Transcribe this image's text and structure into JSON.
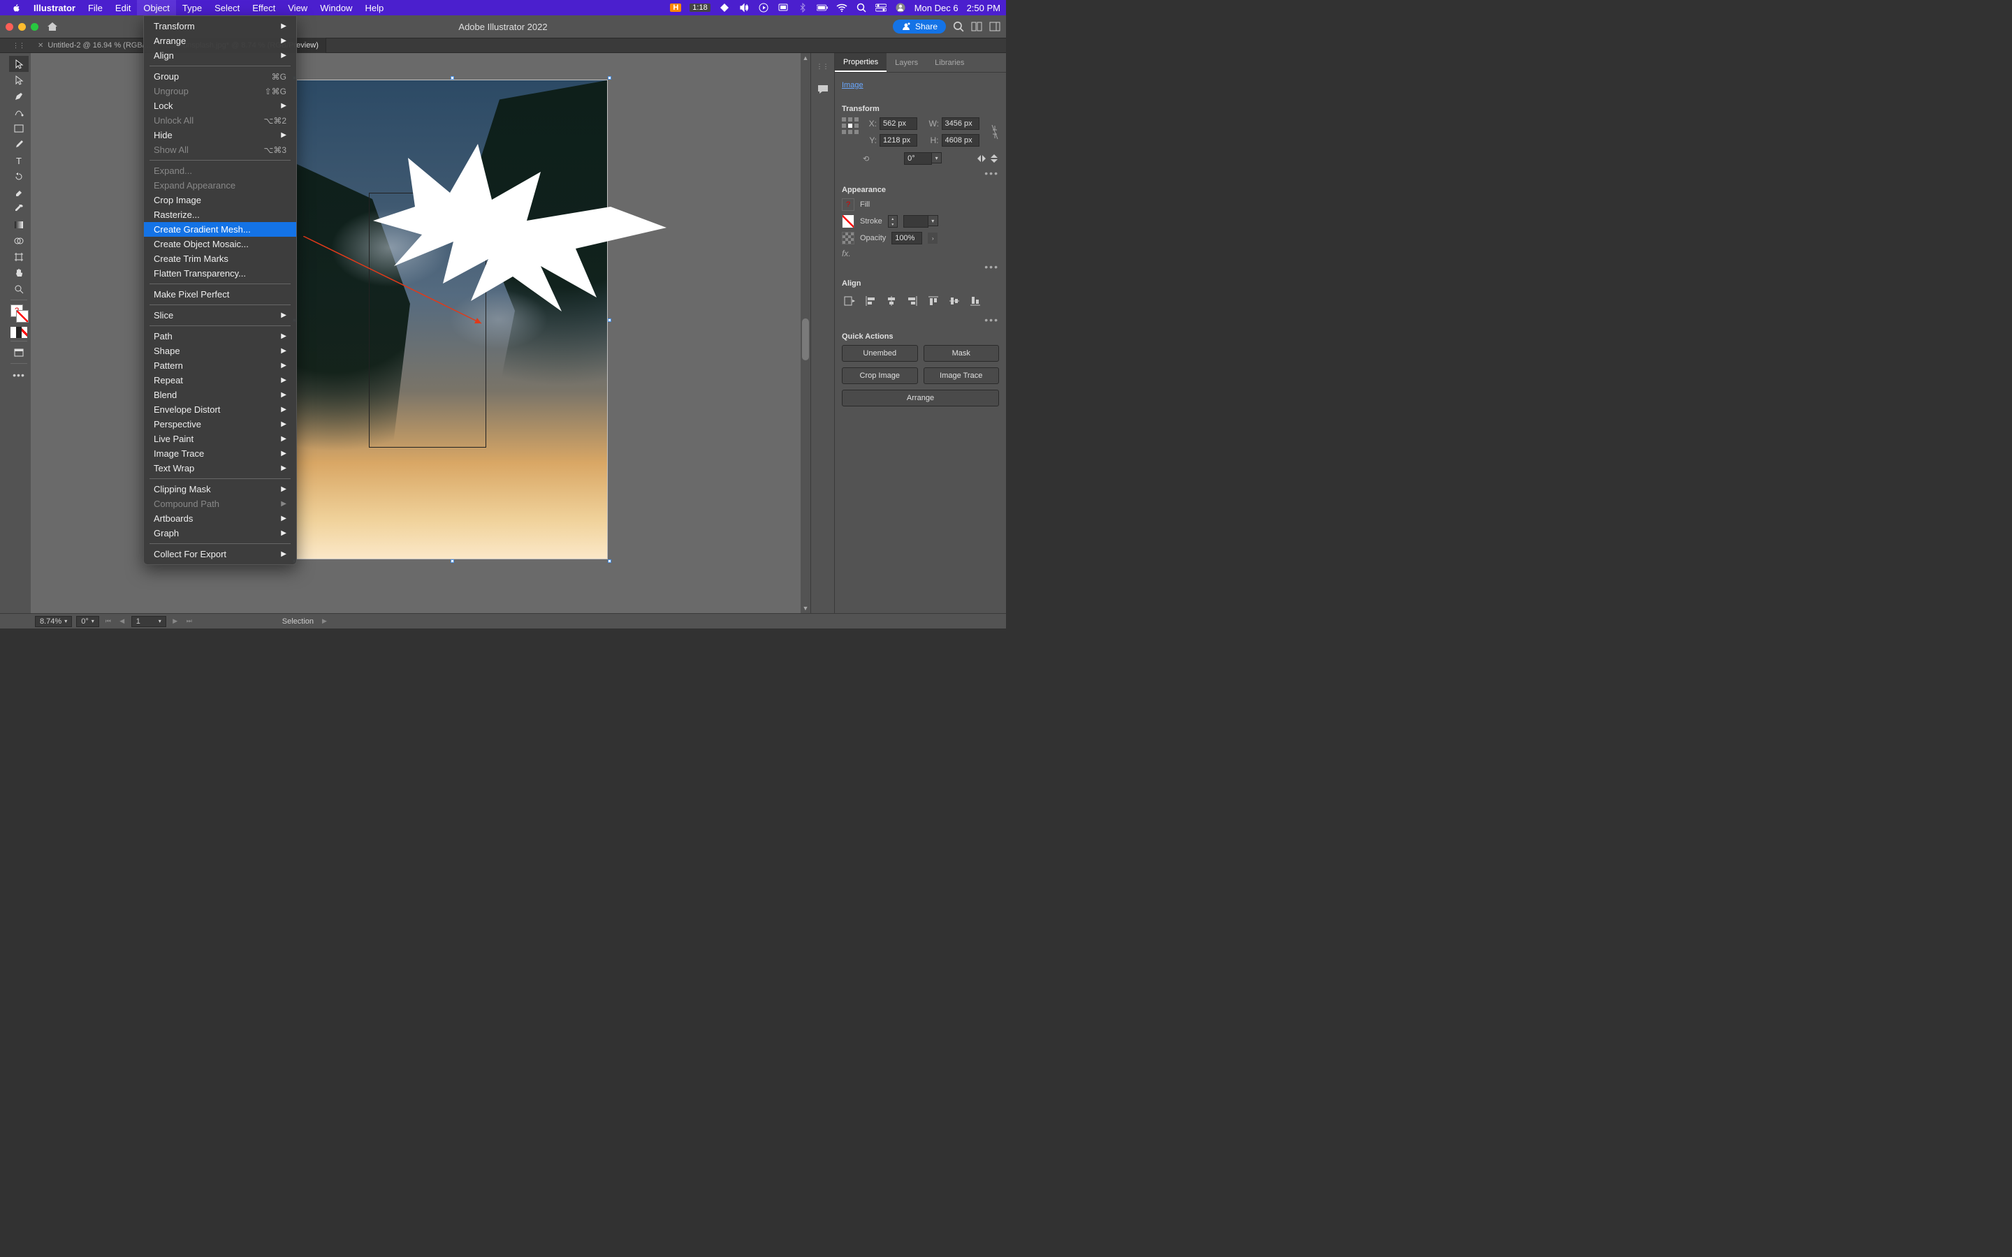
{
  "menubar": {
    "app": "Illustrator",
    "items": [
      "File",
      "Edit",
      "Object",
      "Type",
      "Select",
      "Effect",
      "View",
      "Window",
      "Help"
    ],
    "active_index": 2,
    "right": {
      "h": "H",
      "htime": "1:18",
      "date": "Mon Dec 6",
      "time": "2:50 PM"
    }
  },
  "apptoolbar": {
    "title": "Adobe Illustrator 2022",
    "share": "Share"
  },
  "tabs": [
    {
      "label": "Untitled-2 @ 16.94 % (RGB/...",
      "active": false
    },
    {
      "label": "...30-unsplash.jpg* @ 8.74 % (RGB/Preview)",
      "active": true
    }
  ],
  "dropdown": {
    "groups": [
      [
        {
          "label": "Transform",
          "sub": true
        },
        {
          "label": "Arrange",
          "sub": true
        },
        {
          "label": "Align",
          "sub": true
        }
      ],
      [
        {
          "label": "Group",
          "shortcut": "⌘G"
        },
        {
          "label": "Ungroup",
          "shortcut": "⇧⌘G",
          "disabled": true
        },
        {
          "label": "Lock",
          "sub": true
        },
        {
          "label": "Unlock All",
          "shortcut": "⌥⌘2",
          "disabled": true
        },
        {
          "label": "Hide",
          "sub": true
        },
        {
          "label": "Show All",
          "shortcut": "⌥⌘3",
          "disabled": true
        }
      ],
      [
        {
          "label": "Expand...",
          "disabled": true
        },
        {
          "label": "Expand Appearance",
          "disabled": true
        },
        {
          "label": "Crop Image"
        },
        {
          "label": "Rasterize..."
        },
        {
          "label": "Create Gradient Mesh...",
          "highlighted": true
        },
        {
          "label": "Create Object Mosaic..."
        },
        {
          "label": "Create Trim Marks"
        },
        {
          "label": "Flatten Transparency..."
        }
      ],
      [
        {
          "label": "Make Pixel Perfect"
        }
      ],
      [
        {
          "label": "Slice",
          "sub": true
        }
      ],
      [
        {
          "label": "Path",
          "sub": true
        },
        {
          "label": "Shape",
          "sub": true
        },
        {
          "label": "Pattern",
          "sub": true
        },
        {
          "label": "Repeat",
          "sub": true
        },
        {
          "label": "Blend",
          "sub": true
        },
        {
          "label": "Envelope Distort",
          "sub": true
        },
        {
          "label": "Perspective",
          "sub": true
        },
        {
          "label": "Live Paint",
          "sub": true
        },
        {
          "label": "Image Trace",
          "sub": true
        },
        {
          "label": "Text Wrap",
          "sub": true
        }
      ],
      [
        {
          "label": "Clipping Mask",
          "sub": true
        },
        {
          "label": "Compound Path",
          "sub": true,
          "disabled": true
        },
        {
          "label": "Artboards",
          "sub": true
        },
        {
          "label": "Graph",
          "sub": true
        }
      ],
      [
        {
          "label": "Collect For Export",
          "sub": true
        }
      ]
    ]
  },
  "panel": {
    "tabs": [
      "Properties",
      "Layers",
      "Libraries"
    ],
    "active_tab": 0,
    "image_label": "Image",
    "transform": {
      "title": "Transform",
      "x": "562 px",
      "y": "1218 px",
      "w": "3456 px",
      "h": "4608 px",
      "angle": "0°"
    },
    "appearance": {
      "title": "Appearance",
      "fill": "Fill",
      "stroke": "Stroke",
      "opacity_label": "Opacity",
      "opacity": "100%",
      "fx": "fx."
    },
    "align": {
      "title": "Align"
    },
    "quick_actions": {
      "title": "Quick Actions",
      "buttons": [
        "Unembed",
        "Mask",
        "Crop Image",
        "Image Trace",
        "Arrange"
      ]
    }
  },
  "statusbar": {
    "zoom": "8.74%",
    "angle": "0°",
    "artboard": "1",
    "selection": "Selection"
  }
}
